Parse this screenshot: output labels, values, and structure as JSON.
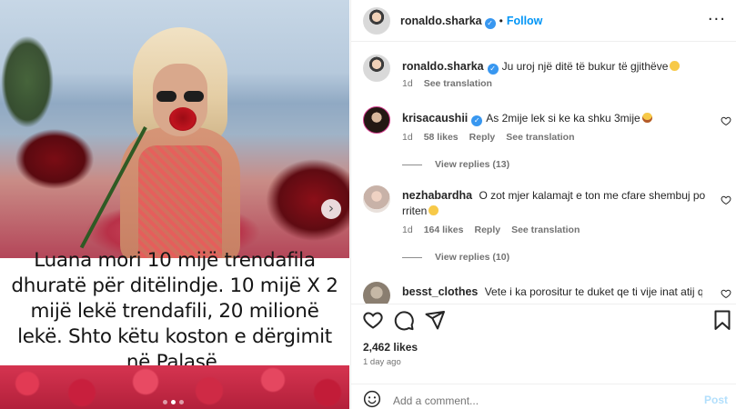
{
  "post": {
    "image_caption": "Luana mori 10 mijë trendafila dhuratë për ditëlindje. 10 mijë X 2 mijë lekë trendafili, 20 milionë lekë. Shto këtu koston e dërgimit në Palasë.",
    "carousel_next_glyph": "›",
    "carousel_dots": 3,
    "active_dot": 1
  },
  "header": {
    "username": "ronaldo.sharka",
    "verified_glyph": "✓",
    "separator": "•",
    "follow_label": "Follow",
    "more_glyph": "···"
  },
  "caption_comment": {
    "username": "ronaldo.sharka",
    "text": "Ju uroj një ditë të bukur të gjithëve",
    "age": "1d",
    "see_translation": "See translation"
  },
  "comments": [
    {
      "username": "krisacaushii",
      "verified": true,
      "text": "As 2mije lek si ke ka shku 3mije",
      "age": "1d",
      "likes": "58 likes",
      "reply": "Reply",
      "see_translation": "See translation",
      "view_replies": "View replies (13)"
    },
    {
      "username": "nezhabardha",
      "verified": false,
      "text": "O zot mjer kalamajt e ton me cfare shembuj po rriten",
      "age": "1d",
      "likes": "164 likes",
      "reply": "Reply",
      "see_translation": "See translation",
      "view_replies": "View replies (10)"
    },
    {
      "username": "besst_clothes",
      "verified": false,
      "text": "Vete i ka porositur te duket qe ti vije inat atij qe"
    }
  ],
  "stats": {
    "likes": "2,462 likes",
    "age": "1 day ago"
  },
  "add_comment": {
    "placeholder": "Add a comment...",
    "post_label": "Post"
  },
  "colors": {
    "accent": "#0095f6",
    "verified": "#3897f0",
    "muted_text": "#737373",
    "post_disabled": "#b2dffc"
  },
  "icons": [
    "chevron-right-icon",
    "verified-icon",
    "more-icon",
    "heart-icon",
    "comment-icon",
    "share-icon",
    "bookmark-icon",
    "emoji-icon"
  ]
}
